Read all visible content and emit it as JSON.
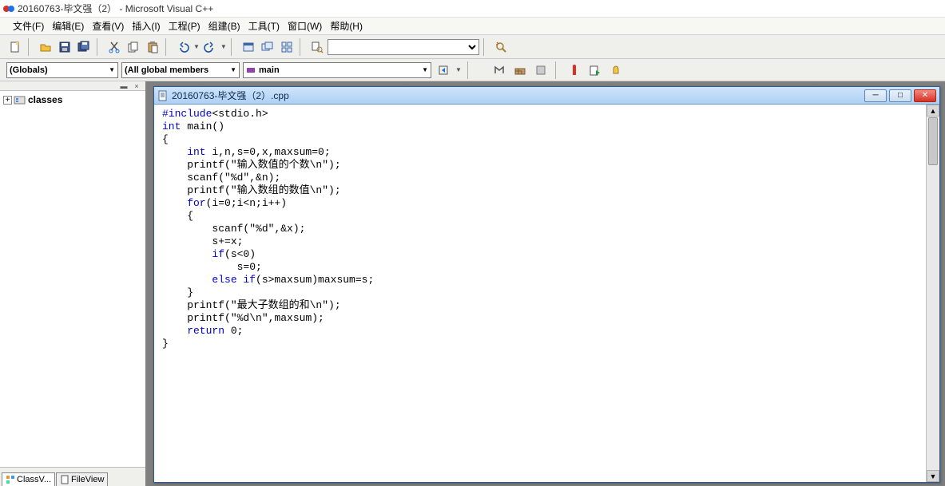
{
  "title": "20160763-毕文强（2）  - Microsoft Visual C++",
  "menus": [
    "文件(F)",
    "编辑(E)",
    "查看(V)",
    "插入(I)",
    "工程(P)",
    "组建(B)",
    "工具(T)",
    "窗口(W)",
    "帮助(H)"
  ],
  "toolbar2": {
    "scope": "(Globals)",
    "members": "(All global members",
    "function": "main"
  },
  "sidebar": {
    "tree_root": "classes",
    "tabs": [
      "ClassV...",
      "FileView"
    ]
  },
  "editor": {
    "doc_title": "20160763-毕文强（2）.cpp",
    "code": {
      "l1a": "#include",
      "l1b": "<stdio.h>",
      "l2a": "int",
      "l2b": " main()",
      "l3": "{",
      "l4a": "    int",
      "l4b": " i,n,s=0,x,maxsum=0;",
      "l5a": "    printf(",
      "l5b": "\"输入数值的个数\\n\"",
      "l5c": ");",
      "l6a": "    scanf(",
      "l6b": "\"%d\"",
      "l6c": ",&n);",
      "l7a": "    printf(",
      "l7b": "\"输入数组的数值\\n\"",
      "l7c": ");",
      "l8a": "    for",
      "l8b": "(i=0;i<n;i++)",
      "l9": "    {",
      "l10a": "        scanf(",
      "l10b": "\"%d\"",
      "l10c": ",&x);",
      "l11": "        s+=x;",
      "l12a": "        if",
      "l12b": "(s<0)",
      "l13": "            s=0;",
      "l14a": "        else if",
      "l14b": "(s>maxsum)maxsum=s;",
      "l15": "    }",
      "l16a": "    printf(",
      "l16b": "\"最大子数组的和\\n\"",
      "l16c": ");",
      "l17a": "    printf(",
      "l17b": "\"%d\\n\"",
      "l17c": ",maxsum);",
      "l18a": "    return",
      "l18b": " 0;",
      "l19": "}"
    }
  }
}
